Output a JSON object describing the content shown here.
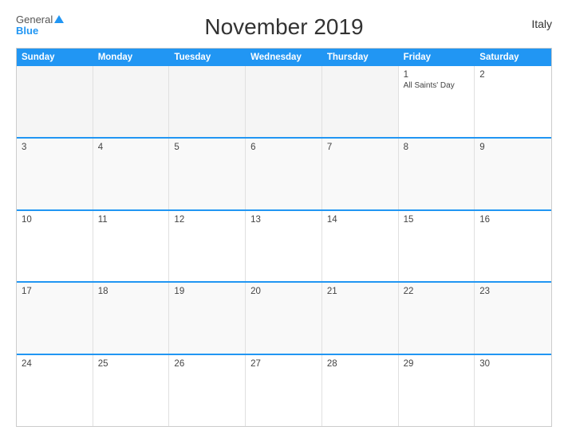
{
  "header": {
    "title": "November 2019",
    "country": "Italy",
    "logo_general": "General",
    "logo_blue": "Blue"
  },
  "calendar": {
    "days": [
      "Sunday",
      "Monday",
      "Tuesday",
      "Wednesday",
      "Thursday",
      "Friday",
      "Saturday"
    ],
    "rows": [
      [
        {
          "num": "",
          "empty": true
        },
        {
          "num": "",
          "empty": true
        },
        {
          "num": "",
          "empty": true
        },
        {
          "num": "",
          "empty": true
        },
        {
          "num": "",
          "empty": true
        },
        {
          "num": "1",
          "event": "All Saints' Day"
        },
        {
          "num": "2"
        }
      ],
      [
        {
          "num": "3"
        },
        {
          "num": "4"
        },
        {
          "num": "5"
        },
        {
          "num": "6"
        },
        {
          "num": "7"
        },
        {
          "num": "8"
        },
        {
          "num": "9"
        }
      ],
      [
        {
          "num": "10"
        },
        {
          "num": "11"
        },
        {
          "num": "12"
        },
        {
          "num": "13"
        },
        {
          "num": "14"
        },
        {
          "num": "15"
        },
        {
          "num": "16"
        }
      ],
      [
        {
          "num": "17"
        },
        {
          "num": "18"
        },
        {
          "num": "19"
        },
        {
          "num": "20"
        },
        {
          "num": "21"
        },
        {
          "num": "22"
        },
        {
          "num": "23"
        }
      ],
      [
        {
          "num": "24"
        },
        {
          "num": "25"
        },
        {
          "num": "26"
        },
        {
          "num": "27"
        },
        {
          "num": "28"
        },
        {
          "num": "29"
        },
        {
          "num": "30"
        }
      ]
    ]
  }
}
